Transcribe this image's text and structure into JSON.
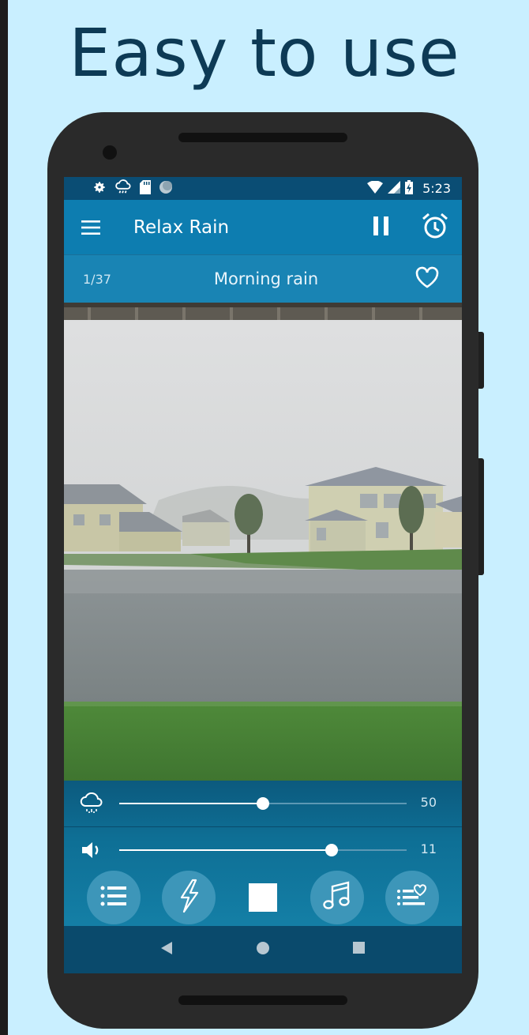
{
  "headline": "Easy to use",
  "status_bar": {
    "time": "5:23",
    "left_icons": [
      "gear-icon",
      "cloud-rain-icon",
      "sd-card-icon",
      "circle-icon"
    ],
    "right_icons": [
      "wifi-icon",
      "signal-icon",
      "battery-charging-icon"
    ]
  },
  "appbar": {
    "title": "Relax Rain",
    "menu_icon": "hamburger-menu-icon",
    "pause_icon": "pause-icon",
    "alarm_icon": "alarm-clock-icon"
  },
  "track": {
    "counter": "1/37",
    "name": "Morning rain",
    "favorite_icon": "heart-outline-icon"
  },
  "rain_slider": {
    "icon": "rain-cloud-icon",
    "value": 50,
    "value_label": "50",
    "fraction": 0.5
  },
  "volume_slider": {
    "icon": "speaker-icon",
    "value": 11,
    "value_label": "11",
    "fraction": 0.74
  },
  "buttons": [
    {
      "name": "playlist-button",
      "icon": "list-icon"
    },
    {
      "name": "thunder-button",
      "icon": "lightning-icon"
    },
    {
      "name": "stop-button",
      "icon": "stop-icon"
    },
    {
      "name": "music-button",
      "icon": "music-note-icon"
    },
    {
      "name": "favorites-list-button",
      "icon": "list-heart-icon"
    }
  ],
  "navbar": {
    "icons": [
      "back-triangle-icon",
      "home-circle-icon",
      "recents-square-icon"
    ]
  },
  "colors": {
    "background": "#c9efff",
    "appbar": "#0d7db0",
    "headline": "#0d3a55"
  }
}
